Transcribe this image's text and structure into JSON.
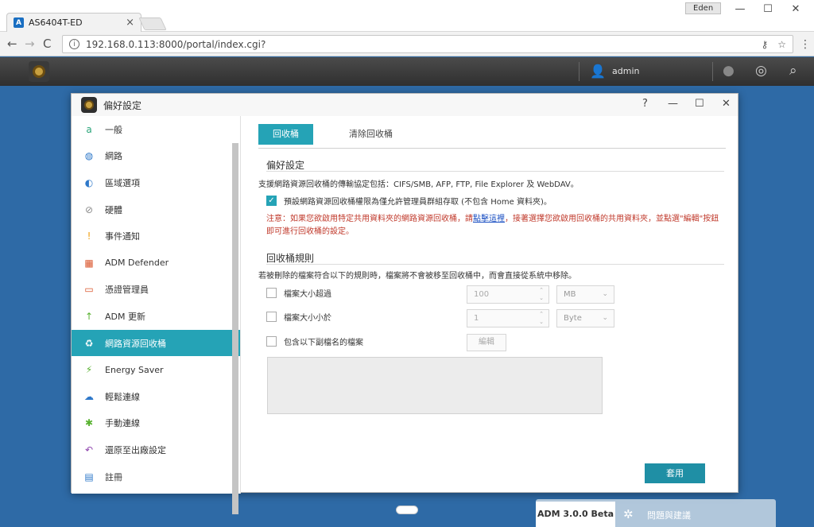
{
  "browser": {
    "tab_title": "AS6404T-ED",
    "tab_close": "×",
    "user_chip": "Eden",
    "win_min": "—",
    "win_max": "☐",
    "win_close": "✕",
    "back": "←",
    "forward": "→",
    "reload": "C",
    "url": "192.168.0.113:8000/portal/index.cgi?",
    "info": "i",
    "key_icon": "⚷",
    "star_icon": "☆",
    "menu_icon": "⋮"
  },
  "admbar": {
    "username": "admin",
    "user_icon": "👤",
    "notify_icon": "●",
    "dashboard_icon": "◎",
    "search_icon": "⌕"
  },
  "dialog": {
    "title": "偏好設定",
    "help": "?",
    "minimize": "—",
    "maximize": "☐",
    "close": "✕"
  },
  "sidebar": {
    "items": [
      {
        "label": "一般",
        "icon": "a",
        "color": "#2aa57a"
      },
      {
        "label": "網路",
        "icon": "◍",
        "color": "#2e78c9"
      },
      {
        "label": "區域選項",
        "icon": "◐",
        "color": "#2e78c9"
      },
      {
        "label": "硬體",
        "icon": "⊘",
        "color": "#8a8a8a"
      },
      {
        "label": "事件通知",
        "icon": "!",
        "color": "#f0a012"
      },
      {
        "label": "ADM Defender",
        "icon": "▦",
        "color": "#d9532a"
      },
      {
        "label": "憑證管理員",
        "icon": "▭",
        "color": "#d9532a"
      },
      {
        "label": "ADM 更新",
        "icon": "↑",
        "color": "#58b230"
      },
      {
        "label": "網路資源回收桶",
        "icon": "♻",
        "color": "#ffffff"
      },
      {
        "label": "Energy Saver",
        "icon": "⚡",
        "color": "#58b230"
      },
      {
        "label": "輕鬆連線",
        "icon": "☁",
        "color": "#2e78c9"
      },
      {
        "label": "手動連線",
        "icon": "✱",
        "color": "#58b230"
      },
      {
        "label": "還原至出廠設定",
        "icon": "↶",
        "color": "#8e44ad"
      },
      {
        "label": "註冊",
        "icon": "▤",
        "color": "#2e78c9"
      }
    ]
  },
  "content": {
    "tab_active": "回收桶",
    "tab_inactive": "清除回收桶",
    "section1": "偏好設定",
    "protocols": "支援網路資源回收桶的傳輸協定包括：CIFS/SMB, AFP, FTP, File Explorer 及 WebDAV。",
    "admin_only": "預設網路資源回收桶權限為僅允許管理員群組存取 (不包含 Home 資料夾)。",
    "warn_pre": "注意：如果您欲啟用特定共用資料夾的網路資源回收桶，請",
    "warn_link": "點擊這裡",
    "warn_post": "，接著選擇您欲啟用回收桶的共用資料夾，並點選\"編輯\"按鈕即可進行回收桶的設定。",
    "section2": "回收桶規則",
    "rule_desc": "若被刪除的檔案符合以下的規則時，檔案將不會被移至回收桶中，而會直接從系統中移除。",
    "size_over": "檔案大小超過",
    "size_over_value": "100",
    "size_over_unit": "MB",
    "size_under": "檔案大小小於",
    "size_under_value": "1",
    "size_under_unit": "Byte",
    "ext": "包含以下副檔名的檔案",
    "edit": "編輯",
    "apply": "套用",
    "check_mark": "✓",
    "spin_up": "⌃",
    "spin_down": "⌄",
    "caret": "⌄"
  },
  "bottom": {
    "version": "ADM 3.0.0 Beta",
    "feedback": "問題與建議",
    "bug_icon": "✲"
  }
}
